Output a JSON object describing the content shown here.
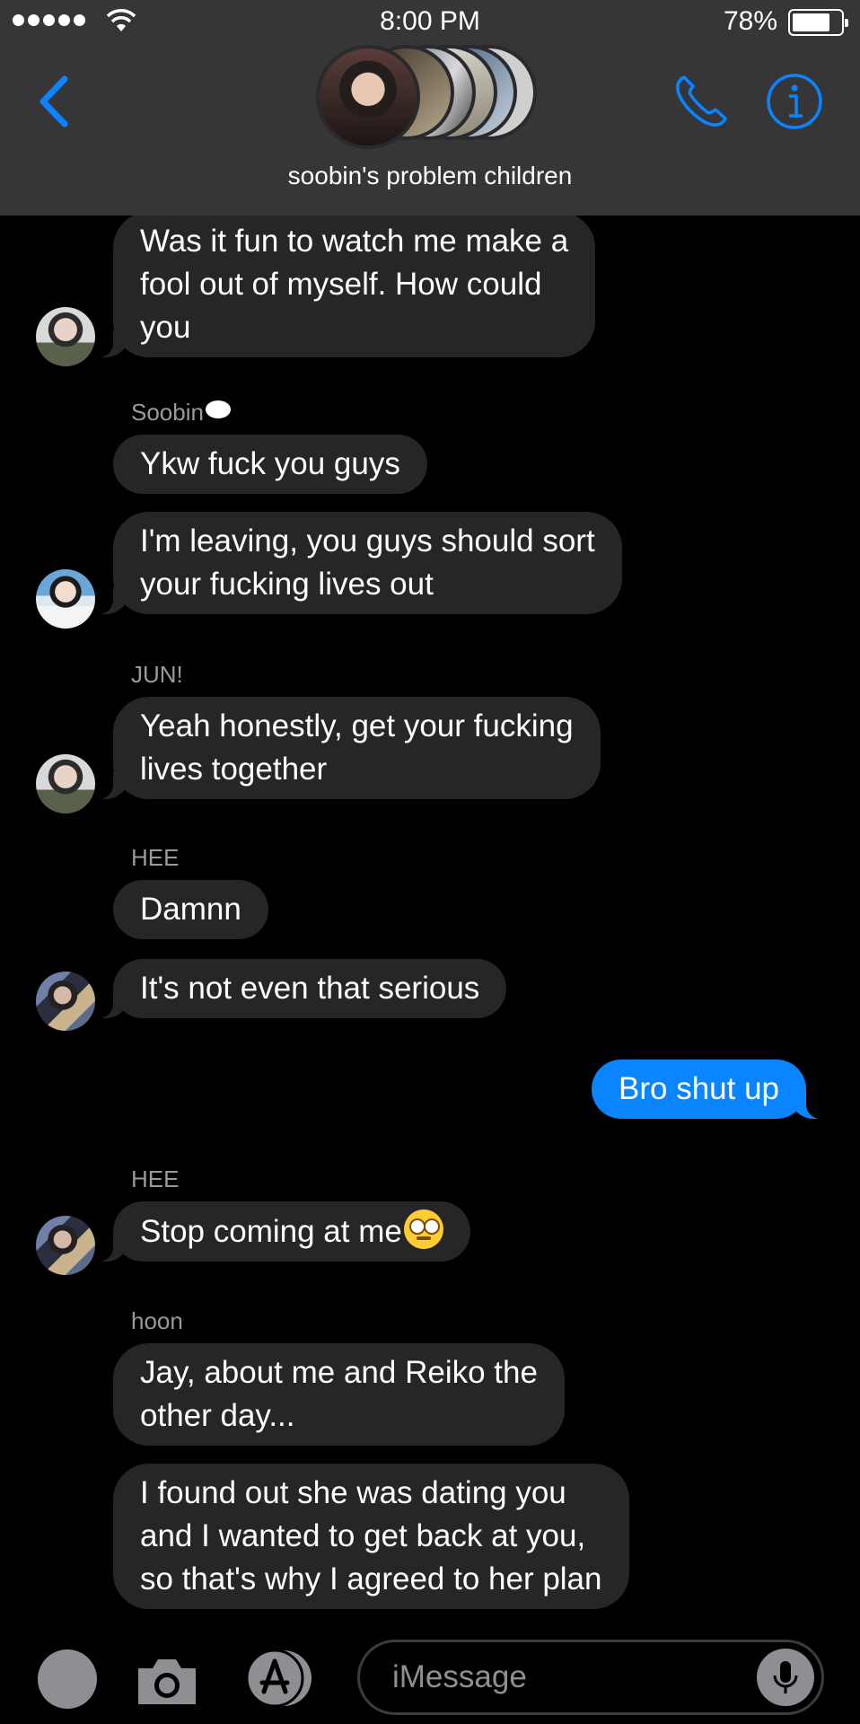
{
  "status_bar": {
    "time": "8:00 PM",
    "battery": "78%",
    "battery_level": 0.78,
    "signal_bars": 5
  },
  "header": {
    "group_name": "soobin's problem children",
    "icons": [
      "back-chevron-icon",
      "phone-icon",
      "info-icon"
    ]
  },
  "messages": [
    {
      "text": "Was it fun to watch me make a\nfool out of myself. How could\nyou",
      "direction": "received"
    },
    {
      "sender": "Soobin",
      "text": "Ykw fuck you guys",
      "direction": "received"
    },
    {
      "text": "I'm leaving, you guys should sort\nyour fucking lives out",
      "direction": "received"
    },
    {
      "sender": "JUN!",
      "text": "Yeah honestly, get your fucking\nlives together",
      "direction": "received"
    },
    {
      "sender": "HEE",
      "text": "Damnn",
      "direction": "received"
    },
    {
      "text": "It's not even that serious",
      "direction": "received"
    },
    {
      "text": "Bro shut up",
      "direction": "sent"
    },
    {
      "sender": "HEE",
      "text": "Stop coming at me",
      "emoji": "face-with-rolling-eyes",
      "direction": "received"
    },
    {
      "sender": "hoon",
      "text": "Jay, about me and Reiko the\nother day...",
      "direction": "received"
    },
    {
      "text": "I found out she was dating you\nand I wanted to get back at you,\nso that's why I agreed to her plan",
      "direction": "received"
    }
  ],
  "input": {
    "placeholder": "iMessage",
    "icons": [
      "apps-circle-icon",
      "camera-icon",
      "app-store-icon",
      "microphone-icon"
    ]
  },
  "colors": {
    "background": "#000000",
    "header_bg": "#363638",
    "received_bubble": "#262629",
    "sent_bubble": "#0b84ff",
    "accent": "#0b84ff",
    "sender_label": "#9a9a9e"
  }
}
